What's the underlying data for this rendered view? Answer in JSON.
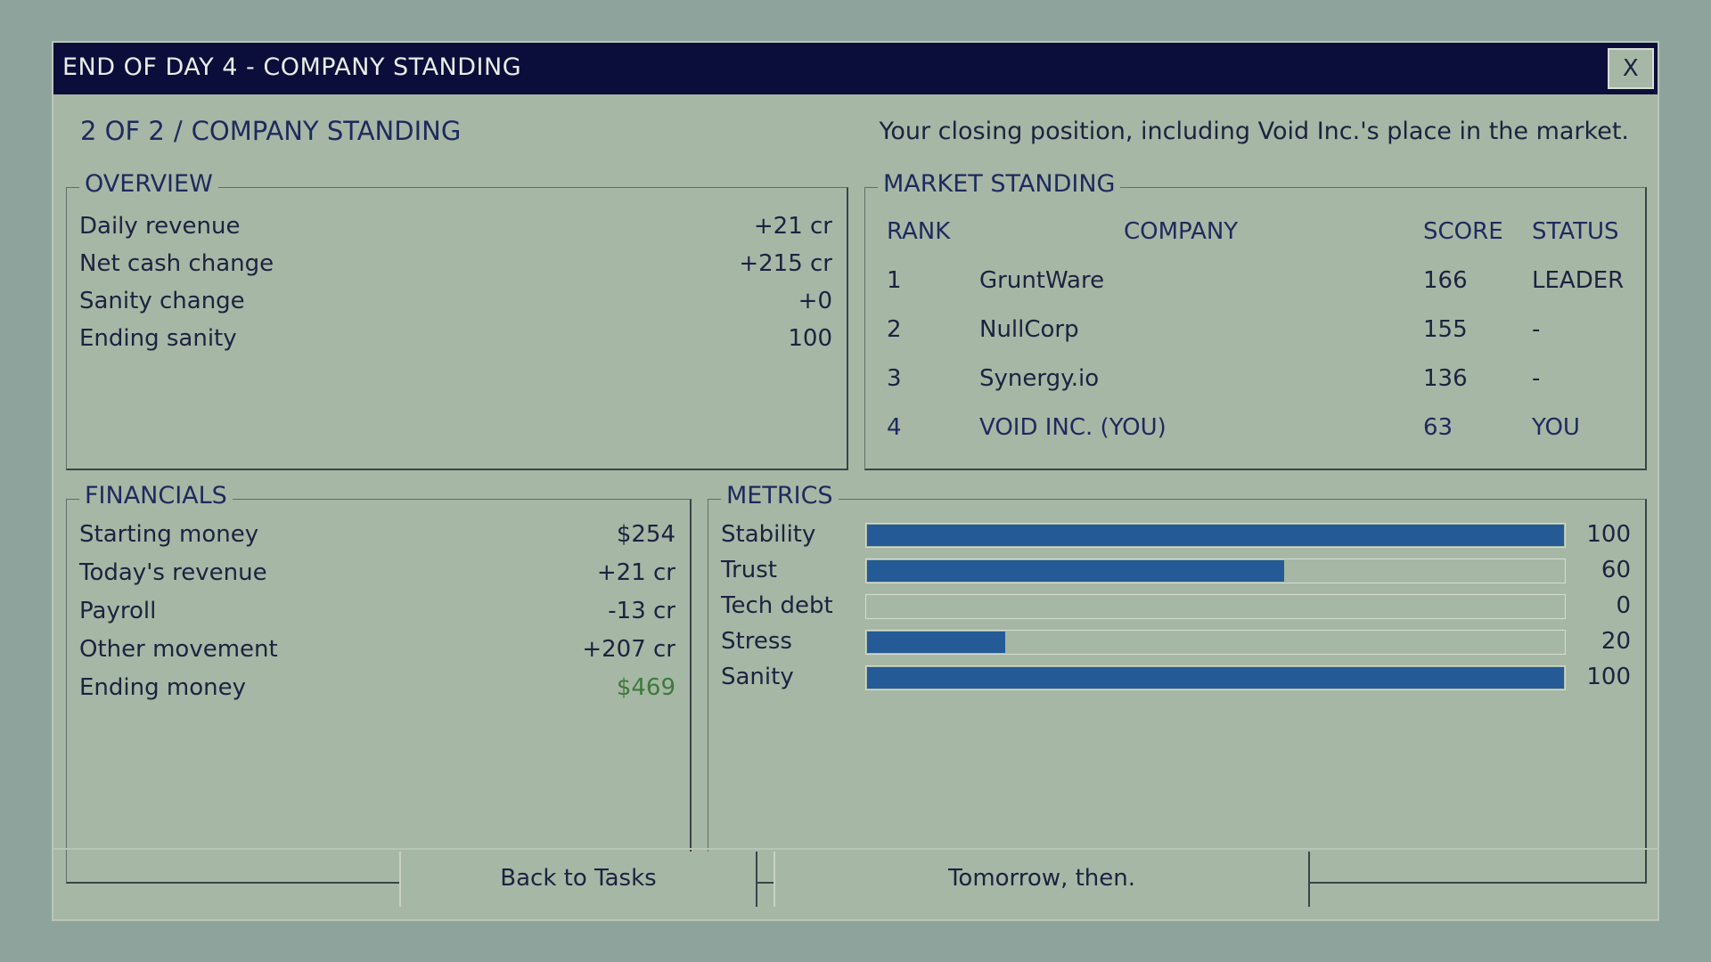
{
  "window": {
    "title": "END OF DAY 4 - COMPANY STANDING",
    "close_label": "X"
  },
  "header": {
    "step": "2 OF 2",
    "separator": "/",
    "section": "COMPANY STANDING",
    "subtitle": "Your closing position, including Void Inc.'s place in the market."
  },
  "overview": {
    "title": "OVERVIEW",
    "rows": [
      {
        "label": "Daily revenue",
        "value": "+21 cr"
      },
      {
        "label": "Net cash change",
        "value": "+215 cr"
      },
      {
        "label": "Sanity change",
        "value": "+0"
      },
      {
        "label": "Ending sanity",
        "value": "100"
      }
    ]
  },
  "market": {
    "title": "MARKET STANDING",
    "headers": {
      "rank": "RANK",
      "company": "COMPANY",
      "score": "SCORE",
      "status": "STATUS"
    },
    "rows": [
      {
        "rank": "1",
        "company": "GruntWare",
        "score": "166",
        "status": "LEADER"
      },
      {
        "rank": "2",
        "company": "NullCorp",
        "score": "155",
        "status": "-"
      },
      {
        "rank": "3",
        "company": "Synergy.io",
        "score": "136",
        "status": "-"
      },
      {
        "rank": "4",
        "company": "VOID INC. (YOU)",
        "score": "63",
        "status": "YOU"
      }
    ]
  },
  "financials": {
    "title": "FINANCIALS",
    "rows": [
      {
        "label": "Starting money",
        "value": "$254"
      },
      {
        "label": "Today's revenue",
        "value": "+21 cr"
      },
      {
        "label": "Payroll",
        "value": "-13 cr"
      },
      {
        "label": "Other movement",
        "value": "+207 cr"
      },
      {
        "label": "Ending money",
        "value": "$469"
      }
    ]
  },
  "metrics": {
    "title": "METRICS",
    "max": 100,
    "items": [
      {
        "label": "Stability",
        "value": "100",
        "level": 100
      },
      {
        "label": "Trust",
        "value": "60",
        "level": 60
      },
      {
        "label": "Tech debt",
        "value": "0",
        "level": 0
      },
      {
        "label": "Stress",
        "value": "20",
        "level": 20
      },
      {
        "label": "Sanity",
        "value": "100",
        "level": 100
      }
    ]
  },
  "actions": {
    "back_label": "Back to Tasks",
    "next_label": "Tomorrow, then."
  },
  "colors": {
    "titlebar": "#0b0d3a",
    "panel_bg": "#a7b7a5",
    "bar_fill": "#245a96",
    "positive_money": "#3c7a3c"
  }
}
